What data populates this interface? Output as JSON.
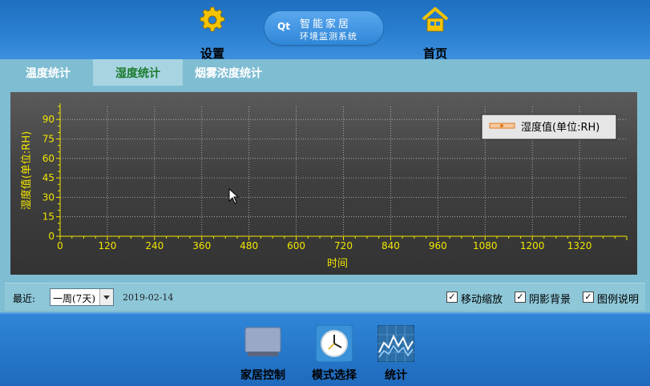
{
  "header": {
    "settings_label": "设置",
    "home_label": "首页",
    "logo": {
      "badge": "Qt",
      "line1": "智能家居",
      "line2": "环境监测系统"
    }
  },
  "tabs": [
    {
      "label": "温度统计",
      "active": false
    },
    {
      "label": "湿度统计",
      "active": true
    },
    {
      "label": "烟雾浓度统计",
      "active": false
    }
  ],
  "chart_data": {
    "type": "line",
    "xlabel": "时间",
    "ylabel": "湿度值(单位:RH)",
    "xlim": [
      0,
      1440
    ],
    "ylim": [
      0,
      100
    ],
    "x_ticks": [
      "0",
      "120",
      "240",
      "360",
      "480",
      "600",
      "720",
      "840",
      "960",
      "1080",
      "1200",
      "1320"
    ],
    "y_ticks": [
      "0",
      "15",
      "30",
      "45",
      "60",
      "75",
      "90"
    ],
    "grid": true,
    "legend_position": "top-right",
    "series": [
      {
        "name": "湿度值(单位:RH)",
        "x": [],
        "y": [],
        "color": "#e07a1f"
      }
    ]
  },
  "controls": {
    "recent_label": "最近:",
    "range_value": "一周(7天)",
    "date": "2019-02-14",
    "checkboxes": [
      {
        "label": "移动缩放",
        "checked": true
      },
      {
        "label": "阴影背景",
        "checked": true
      },
      {
        "label": "图例说明",
        "checked": true
      }
    ]
  },
  "bottom_nav": {
    "home_control": "家居控制",
    "mode_select": "模式选择",
    "statistics": "统计"
  },
  "colors": {
    "accent": "#2f86d8",
    "axis": "#f2e600",
    "tab_active_text": "#1a7a2a"
  }
}
